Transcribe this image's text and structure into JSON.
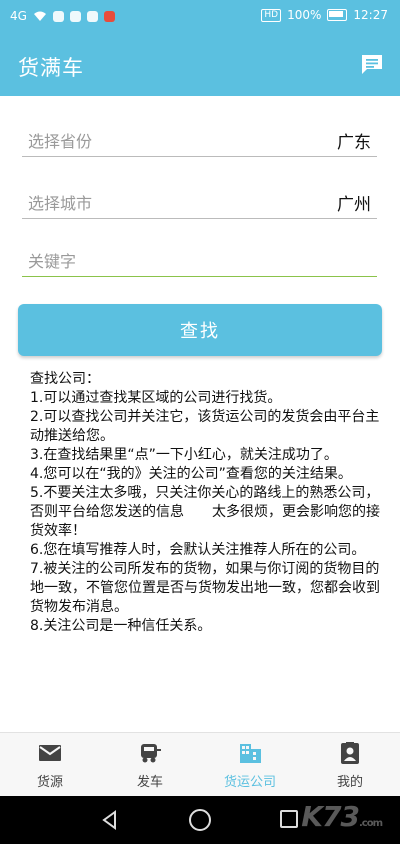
{
  "status_bar": {
    "network": "4G",
    "hd": "HD",
    "battery": "100%",
    "time": "12:27"
  },
  "app_bar": {
    "title": "货满车",
    "message_icon": "message-icon"
  },
  "form": {
    "province": {
      "placeholder": "选择省份",
      "value": "广东"
    },
    "city": {
      "placeholder": "选择城市",
      "value": "广州"
    },
    "keyword": {
      "placeholder": "关键字"
    },
    "search_label": "查找"
  },
  "help": {
    "lines": [
      "查找公司：",
      "1.可以通过查找某区域的公司进行找货。",
      "2.可以查找公司并关注它，该货运公司的发货会由平台主动推送给您。",
      "3.在查找结果里“点”一下小红心，就关注成功了。",
      "4.您可以在“我的》关注的公司”查看您的关注结果。",
      "5.不要关注太多哦，只关注你关心的路线上的熟悉公司，否则平台给您发送的信息　　太多很烦，更会影响您的接货效率！",
      "6.您在填写推荐人时，会默认关注推荐人所在的公司。",
      "7.被关注的公司所发布的货物，如果与你订阅的货物目的地一致，不管您位置是否与货物发出地一致，您都会收到货物发布消息。",
      "8.关注公司是一种信任关系。"
    ]
  },
  "bottom_nav": {
    "items": [
      {
        "label": "货源",
        "icon": "mail-icon",
        "active": false
      },
      {
        "label": "发车",
        "icon": "truck-icon",
        "active": false
      },
      {
        "label": "货运公司",
        "icon": "building-icon",
        "active": true
      },
      {
        "label": "我的",
        "icon": "profile-card-icon",
        "active": false
      }
    ]
  },
  "watermark": {
    "text": "K73",
    "suffix": ".com"
  },
  "colors": {
    "primary": "#5bc0e0",
    "focus_underline": "#8bc34a",
    "nav_inactive": "#444444"
  }
}
